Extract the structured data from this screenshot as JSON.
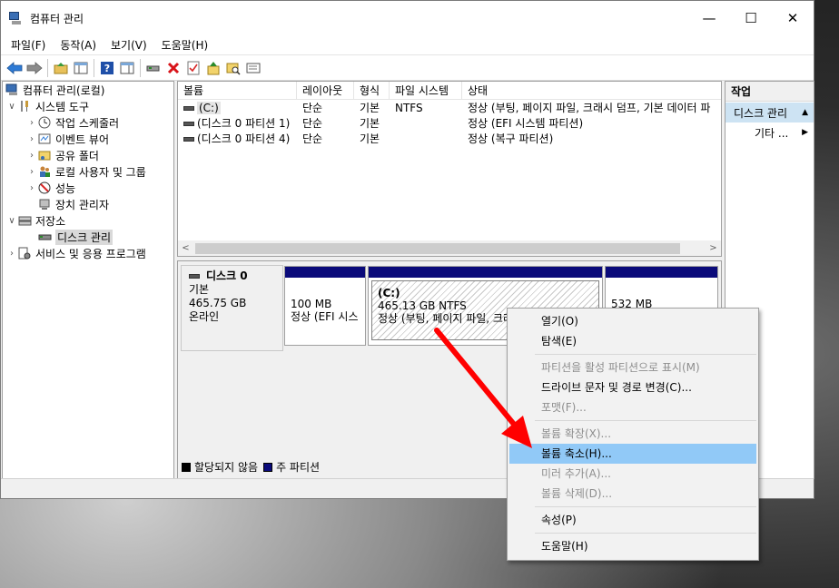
{
  "window": {
    "title": "컴퓨터 관리",
    "controls": {
      "minimize": "—",
      "maximize": "☐",
      "close": "✕"
    }
  },
  "menubar": [
    "파일(F)",
    "동작(A)",
    "보기(V)",
    "도움말(H)"
  ],
  "toolbar": {
    "icons": [
      "back-arrow-icon",
      "forward-arrow-icon",
      "up-folder-icon",
      "show-hide-tree-icon",
      "help-icon",
      "properties-pane-icon",
      "connect-icon",
      "delete-icon",
      "checklist-icon",
      "export-icon",
      "search-folder-icon",
      "console-icon"
    ]
  },
  "tree": {
    "root": "컴퓨터 관리(로컬)",
    "system_tools": "시스템 도구",
    "task_scheduler": "작업 스케줄러",
    "event_viewer": "이벤트 뷰어",
    "shared_folders": "공유 폴더",
    "local_users": "로컬 사용자 및 그룹",
    "performance": "성능",
    "device_manager": "장치 관리자",
    "storage": "저장소",
    "disk_management": "디스크 관리",
    "services": "서비스 및 응용 프로그램"
  },
  "volume_list": {
    "headers": [
      "볼륨",
      "레이아웃",
      "형식",
      "파일 시스템",
      "상태"
    ],
    "rows": [
      {
        "volume": "(C:)",
        "layout": "단순",
        "type": "기본",
        "fs": "NTFS",
        "status": "정상 (부팅, 페이지 파일, 크래시 덤프, 기본 데이터 파"
      },
      {
        "volume": "(디스크 0 파티션 1)",
        "layout": "단순",
        "type": "기본",
        "fs": "",
        "status": "정상 (EFI 시스템 파티션)"
      },
      {
        "volume": "(디스크 0 파티션 4)",
        "layout": "단순",
        "type": "기본",
        "fs": "",
        "status": "정상 (복구 파티션)"
      }
    ]
  },
  "disk": {
    "name": "디스크 0",
    "type": "기본",
    "size": "465.75 GB",
    "state": "온라인",
    "partitions": [
      {
        "line1": "",
        "line2": "100 MB",
        "line3": "정상 (EFI 시스"
      },
      {
        "line1": "(C:)",
        "line2": "465.13 GB NTFS",
        "line3": "정상 (부팅, 페이지 파일, 크래"
      },
      {
        "line1": "",
        "line2": "532 MB",
        "line3": ""
      }
    ]
  },
  "legend": {
    "unallocated": "할당되지 않음",
    "primary": "주 파티션"
  },
  "actions": {
    "title": "작업",
    "head": "디스크 관리",
    "more": "기타 ..."
  },
  "context_menu": {
    "items": [
      {
        "label": "열기(O)",
        "disabled": false
      },
      {
        "label": "탐색(E)",
        "disabled": false
      },
      {
        "label": "파티션을 활성 파티션으로 표시(M)",
        "disabled": true
      },
      {
        "label": "드라이브 문자 및 경로 변경(C)...",
        "disabled": false
      },
      {
        "label": "포맷(F)...",
        "disabled": true
      },
      {
        "label": "볼륨 확장(X)...",
        "disabled": true
      },
      {
        "label": "볼륨 축소(H)...",
        "disabled": false,
        "highlighted": true
      },
      {
        "label": "미러 추가(A)...",
        "disabled": true
      },
      {
        "label": "볼륨 삭제(D)...",
        "disabled": true
      },
      {
        "label": "속성(P)",
        "disabled": false
      },
      {
        "label": "도움말(H)",
        "disabled": false
      }
    ]
  },
  "colors": {
    "primary_partition": "#0a0a7a",
    "menu_highlight": "#91c9f7",
    "annotation_arrow": "#ff0000"
  }
}
